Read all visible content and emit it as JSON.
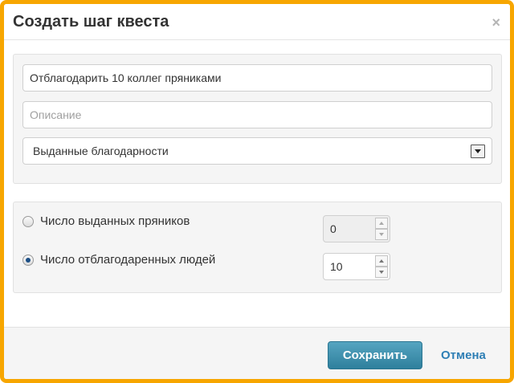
{
  "dialog": {
    "title": "Создать шаг квеста",
    "close_label": "×"
  },
  "form": {
    "name_value": "Отблагодарить 10 коллег пряниками",
    "description_placeholder": "Описание",
    "type_select": {
      "selected": "Выданные благодарности"
    }
  },
  "criteria": {
    "options": [
      {
        "label": "Число выданных пряников",
        "checked": false,
        "value": "0",
        "disabled": true
      },
      {
        "label": "Число отблагодаренных людей",
        "checked": true,
        "value": "10",
        "disabled": false
      }
    ]
  },
  "footer": {
    "save_label": "Сохранить",
    "cancel_label": "Отмена"
  },
  "colors": {
    "frame_border": "#f7a600",
    "primary_button": "#3d8fae",
    "link": "#2e7fb5",
    "radio_checked": "#1c4f86"
  }
}
